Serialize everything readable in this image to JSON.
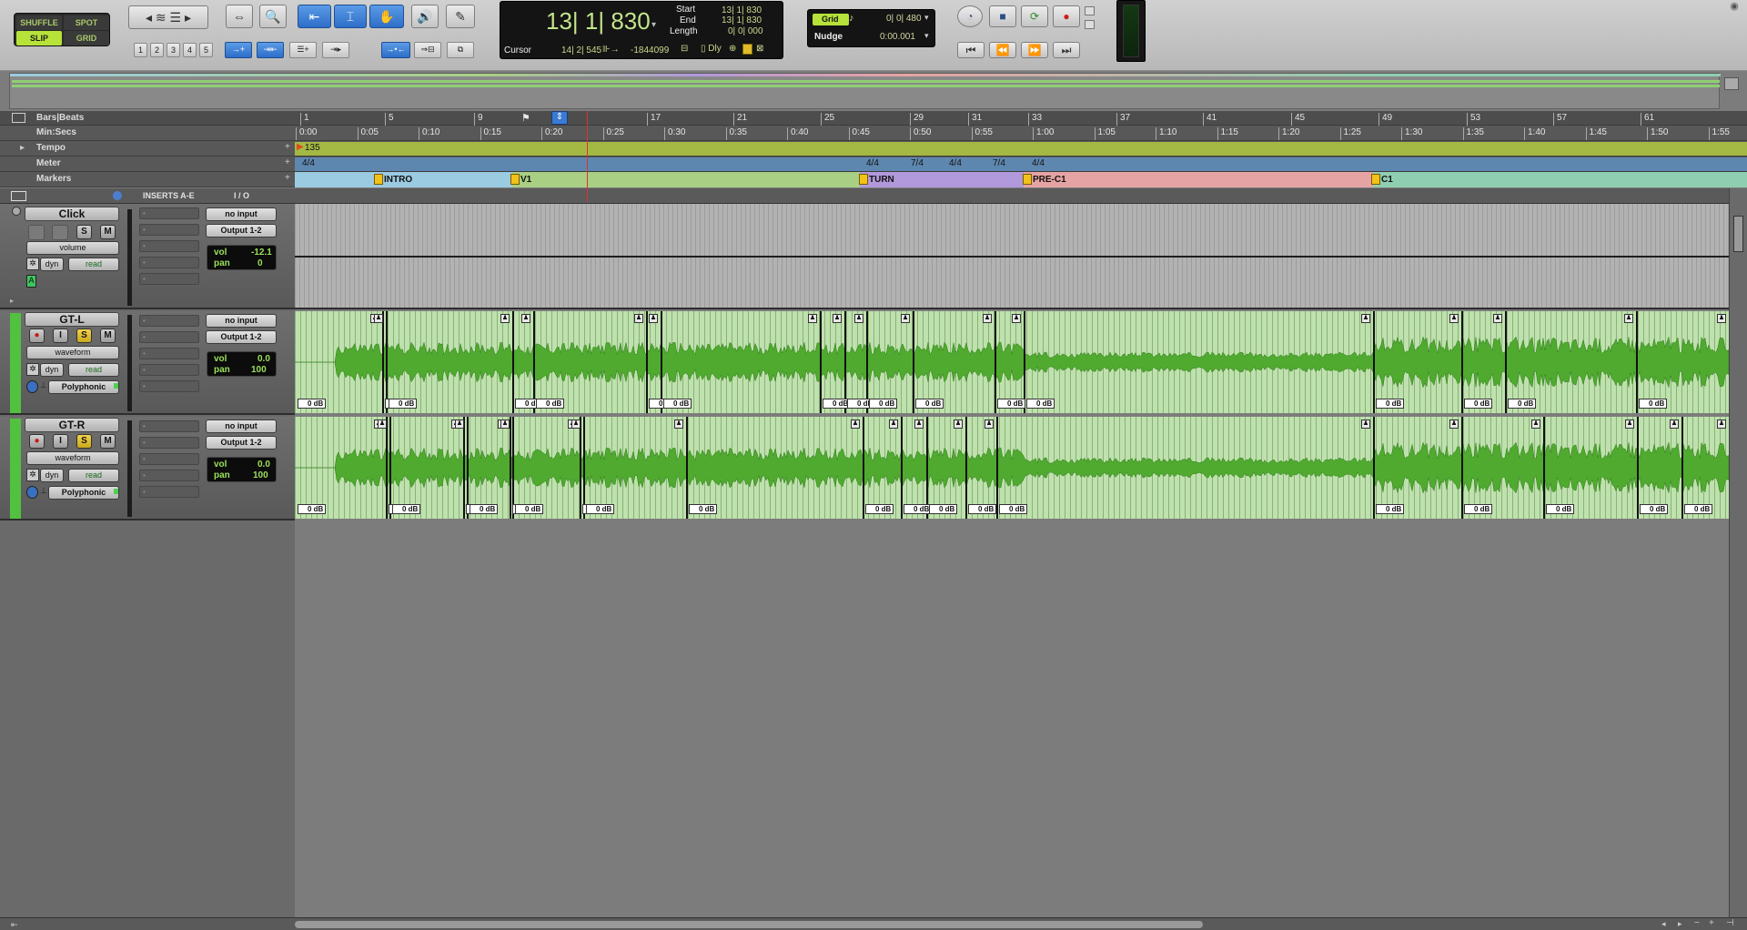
{
  "toolbar": {
    "edit_modes": {
      "shuffle": "SHUFFLE",
      "spot": "SPOT",
      "slip": "SLIP",
      "grid": "GRID"
    },
    "zoom_presets": [
      "1",
      "2",
      "3",
      "4",
      "5"
    ],
    "tools": [
      {
        "icon": "zoom-icon",
        "active": false
      },
      {
        "icon": "trim-icon",
        "active": true
      },
      {
        "icon": "selector-icon",
        "active": true
      },
      {
        "icon": "grabber-hand-icon",
        "active": true
      },
      {
        "icon": "scrub-speaker-icon",
        "active": false
      },
      {
        "icon": "pencil-icon",
        "active": false
      }
    ]
  },
  "counter": {
    "main": "13| 1| 830",
    "start_label": "Start",
    "start_value": "13| 1| 830",
    "end_label": "End",
    "end_value": "13| 1| 830",
    "length_label": "Length",
    "length_value": "0| 0| 000",
    "cursor_label": "Cursor",
    "cursor_value": "14| 2| 545",
    "sample_value": "-1844099",
    "dly_label": "Dly"
  },
  "grid_nudge": {
    "grid_label": "Grid",
    "grid_value": "0| 0| 480",
    "nudge_label": "Nudge",
    "nudge_value": "0:00.001"
  },
  "rulers": {
    "bars_label": "Bars|Beats",
    "minsecs_label": "Min:Secs",
    "tempo_label": "Tempo",
    "meter_label": "Meter",
    "markers_label": "Markers",
    "bars_ticks": [
      "1",
      "5",
      "9",
      "17",
      "21",
      "25",
      "29",
      "31",
      "33",
      "37",
      "41",
      "45",
      "49",
      "53",
      "57",
      "61"
    ],
    "minsecs_ticks": [
      "0:00",
      "0:05",
      "0:10",
      "0:15",
      "0:20",
      "0:25",
      "0:30",
      "0:35",
      "0:40",
      "0:45",
      "0:50",
      "0:55",
      "1:00",
      "1:05",
      "1:10",
      "1:15",
      "1:20",
      "1:25",
      "1:30",
      "1:35",
      "1:40",
      "1:45",
      "1:50",
      "1:55"
    ],
    "tempo_value": "135",
    "meter_events": [
      "4/4",
      "4/4",
      "7/4",
      "4/4",
      "7/4",
      "4/4"
    ],
    "markers": [
      "INTRO",
      "V1",
      "TURN",
      "PRE-C1",
      "C1"
    ]
  },
  "column_headers": {
    "inserts": "INSERTS A-E",
    "io": "I / O"
  },
  "tracks": [
    {
      "name": "Click",
      "solo": "S",
      "mute": "M",
      "view": "volume",
      "auto_mode": "read",
      "dyn": "dyn",
      "input": "no input",
      "output": "Output 1-2",
      "vol_label": "vol",
      "vol_value": "-12.1",
      "pan_label": "pan",
      "pan_value": "0"
    },
    {
      "name": "GT-L",
      "solo": "S",
      "mute": "M",
      "view": "waveform",
      "auto_mode": "read",
      "dyn": "dyn",
      "elastic": "Polyphonic",
      "input": "no input",
      "output": "Output 1-2",
      "vol_label": "vol",
      "vol_value": "0.0",
      "pan_label": "pan",
      "pan_value": "100",
      "clip_gain": "0 dB"
    },
    {
      "name": "GT-R",
      "solo": "S",
      "mute": "M",
      "view": "waveform",
      "auto_mode": "read",
      "dyn": "dyn",
      "elastic": "Polyphonic",
      "input": "no input",
      "output": "Output 1-2",
      "vol_label": "vol",
      "vol_value": "0.0",
      "pan_label": "pan",
      "pan_value": "100",
      "clip_gain": "0 dB"
    }
  ],
  "colors": {
    "clip_fill": "#bfe1ad",
    "waveform": "#4faa2f",
    "tempo_ruler": "#a4b944",
    "meter_ruler": "#5e87b0",
    "marker_intro": "#9bcbe1",
    "marker_v1": "#a8cf83",
    "marker_turn": "#b199db",
    "marker_pre": "#e6a3a3",
    "marker_c1": "#8fceb1",
    "playhead": "#e03030"
  }
}
